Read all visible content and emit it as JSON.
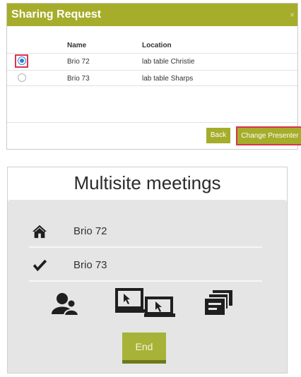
{
  "sharing_request": {
    "title": "Sharing Request",
    "close_glyph": "×",
    "columns": {
      "name": "Name",
      "location": "Location"
    },
    "rows": [
      {
        "name": "Brio 72",
        "location": "lab table Christie",
        "selected": true
      },
      {
        "name": "Brio 73",
        "location": "lab table Sharps",
        "selected": false
      }
    ],
    "buttons": {
      "back": "Back",
      "change_presenter": "Change Presenter"
    },
    "colors": {
      "accent": "#a5ad2a",
      "highlight": "#d8344a",
      "radio": "#2e7bde"
    }
  },
  "multisite": {
    "title": "Multisite meetings",
    "sites": [
      {
        "icon": "home-icon",
        "name": "Brio 72"
      },
      {
        "icon": "checkmark-icon",
        "name": "Brio 73"
      }
    ],
    "actions": [
      {
        "icon": "participants-icon"
      },
      {
        "icon": "screen-share-icon"
      },
      {
        "icon": "layout-stack-icon"
      }
    ],
    "end_label": "End",
    "colors": {
      "end_button": "#a7b338",
      "panel_bg": "#e5e5e5"
    }
  }
}
